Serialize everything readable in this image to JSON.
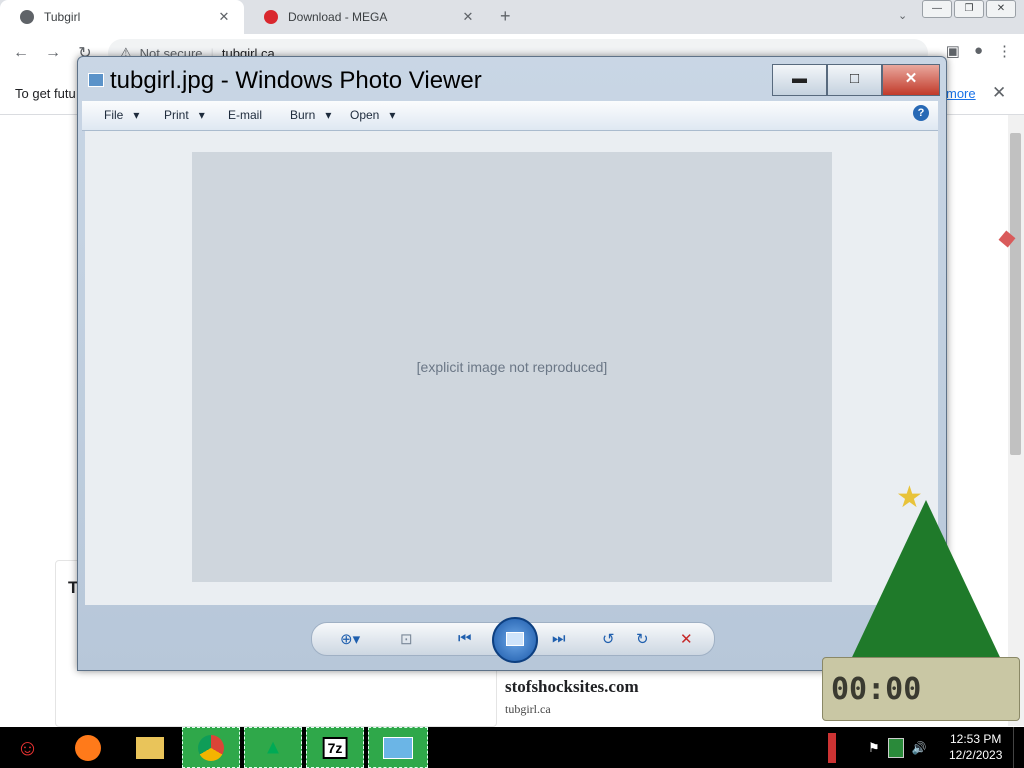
{
  "browser": {
    "tabs": [
      {
        "title": "Tubgirl",
        "active": true
      },
      {
        "title": "Download - MEGA",
        "active": false
      }
    ],
    "security_label": "Not secure",
    "url": "tubgirl.ca",
    "infobar_text": "To get futu",
    "infobar_link": "more"
  },
  "page": {
    "card_title": "T",
    "site_name": "stofshocksites.com",
    "site_url": "tubgirl.ca"
  },
  "photo_viewer": {
    "title": "tubgirl.jpg - Windows Photo Viewer",
    "menu": [
      "File",
      "Print",
      "E-mail",
      "Burn",
      "Open"
    ],
    "menu_has_dropdown": [
      true,
      true,
      false,
      true,
      true
    ],
    "photo_note": "[explicit image not reproduced]"
  },
  "taskbar": {
    "time": "12:53 PM",
    "date": "12/2/2023",
    "seven_zip_label": "7z"
  },
  "colors": {
    "taskbar": "#000000",
    "viewer_frame": "#c9d6e5",
    "close_button": "#c13a2a",
    "link": "#1a73e8"
  }
}
